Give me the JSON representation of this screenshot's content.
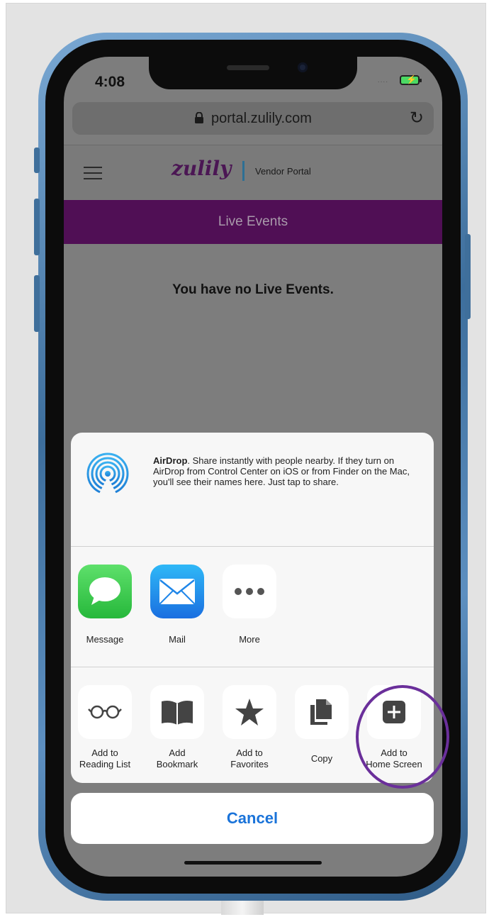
{
  "status_bar": {
    "time": "4:08",
    "signal": "....",
    "battery_state": "charging"
  },
  "browser": {
    "url": "portal.zulily.com",
    "reload_icon": "reload-icon",
    "lock_icon": "lock-icon"
  },
  "site": {
    "logo": "zulily",
    "subtitle": "Vendor Portal",
    "menu_icon": "hamburger-icon",
    "section_title": "Live Events",
    "empty_message": "You have no Live Events.",
    "brand_color": "#500f55"
  },
  "share_sheet": {
    "airdrop": {
      "title": "AirDrop",
      "description": ". Share instantly with people nearby. If they turn on AirDrop from Control Center on iOS or from Finder on the Mac, you'll see their names here. Just tap to share."
    },
    "apps": [
      {
        "label": "Message",
        "icon": "message-icon"
      },
      {
        "label": "Mail",
        "icon": "mail-icon"
      },
      {
        "label": "More",
        "icon": "more-icon"
      }
    ],
    "actions": [
      {
        "label": "Add to\nReading List",
        "icon": "glasses-icon"
      },
      {
        "label": "Add\nBookmark",
        "icon": "book-icon"
      },
      {
        "label": "Add to\nFavorites",
        "icon": "star-icon"
      },
      {
        "label": "Copy",
        "icon": "copy-icon"
      },
      {
        "label": "Add to\nHome Screen",
        "icon": "add-square-icon"
      }
    ],
    "cancel_label": "Cancel"
  },
  "annotation": {
    "highlight_color": "#6a2f9a"
  }
}
